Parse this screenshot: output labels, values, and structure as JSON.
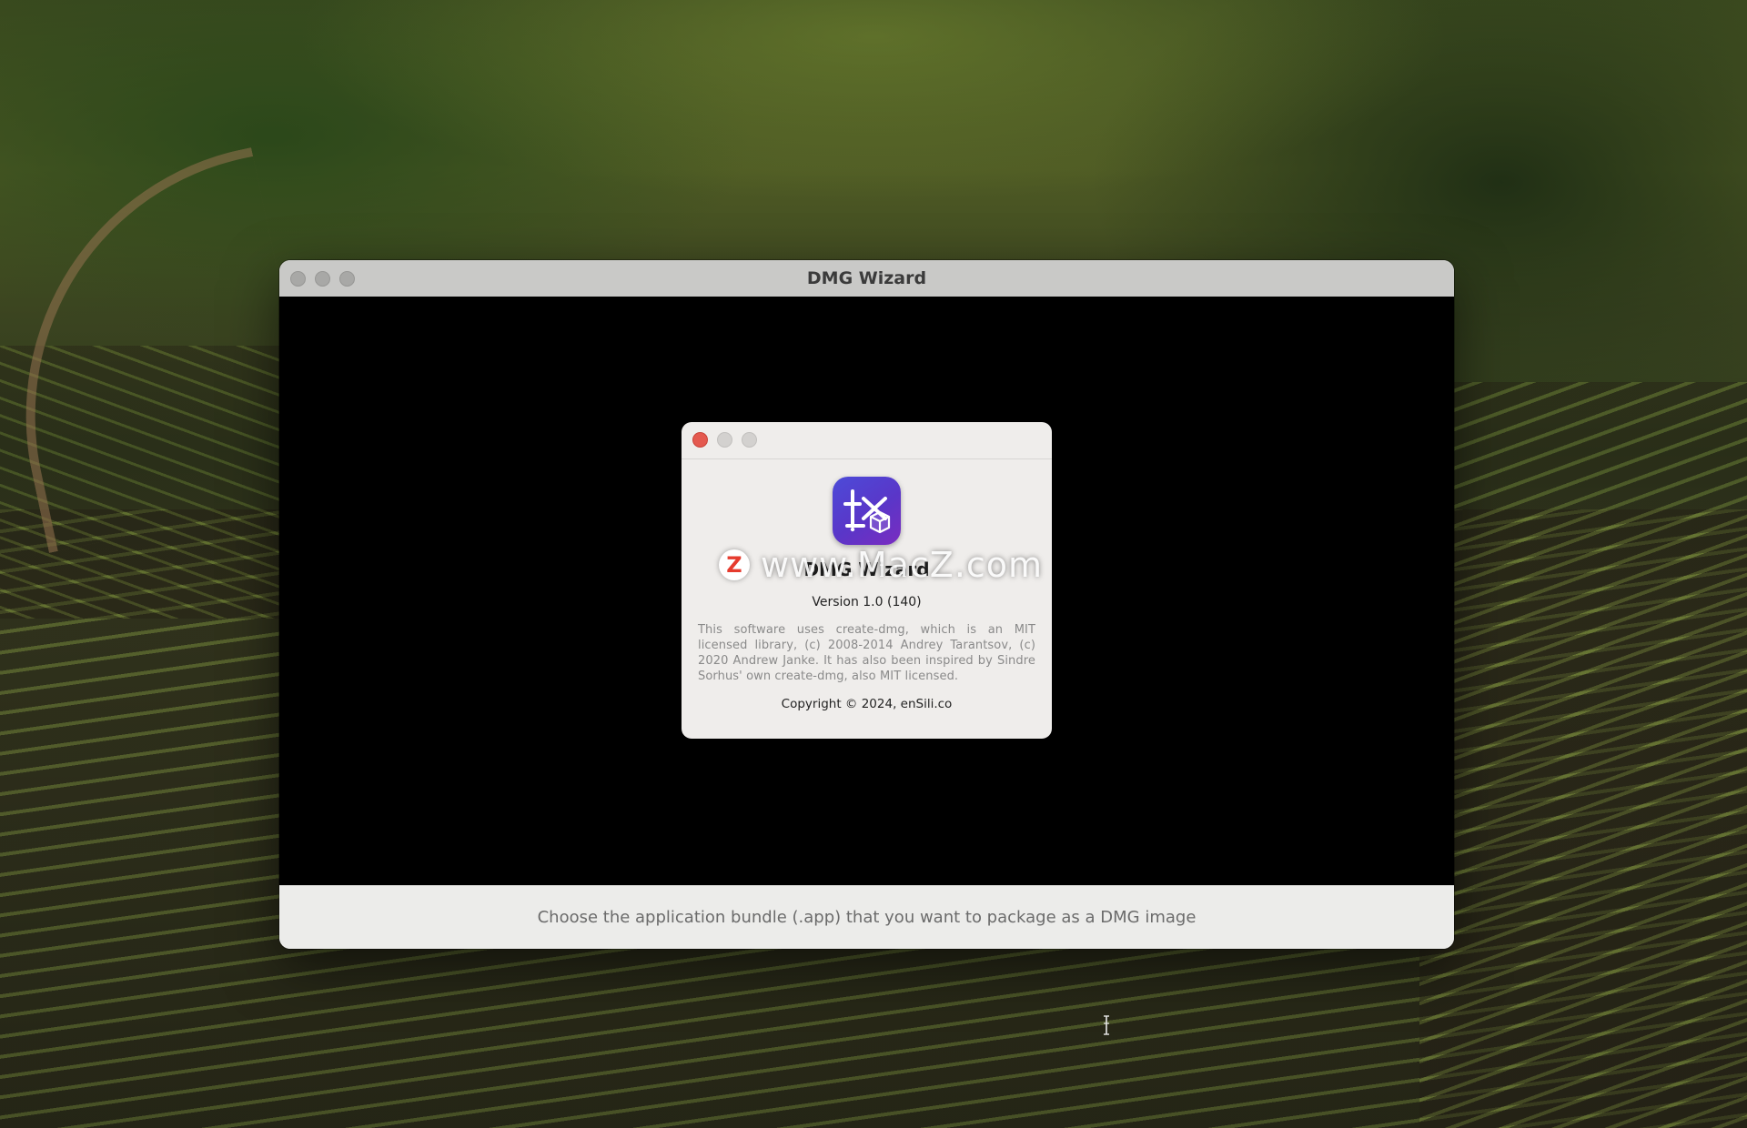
{
  "main_window": {
    "title": "DMG Wizard",
    "status_text": "Choose the application bundle (.app) that you want to package as a DMG image"
  },
  "about_dialog": {
    "app_name": "DMG Wizard",
    "version": "Version 1.0 (140)",
    "credits": "This software uses create-dmg, which is an MIT licensed library,  (c) 2008-2014 Andrey Tarantsov, (c) 2020 Andrew Janke. It has also been inspired by Sindre Sorhus' own create-dmg, also MIT licensed.",
    "copyright": "Copyright © 2024, enSili.co"
  },
  "watermark": {
    "badge": "Z",
    "text": "www.MacZ.com"
  },
  "colors": {
    "close_button": "#e4594f",
    "icon_gradient_start": "#4c4bd8",
    "icon_gradient_end": "#7a2cc0"
  },
  "icons": {
    "app_icon": "dmg-wizard-app-icon"
  }
}
